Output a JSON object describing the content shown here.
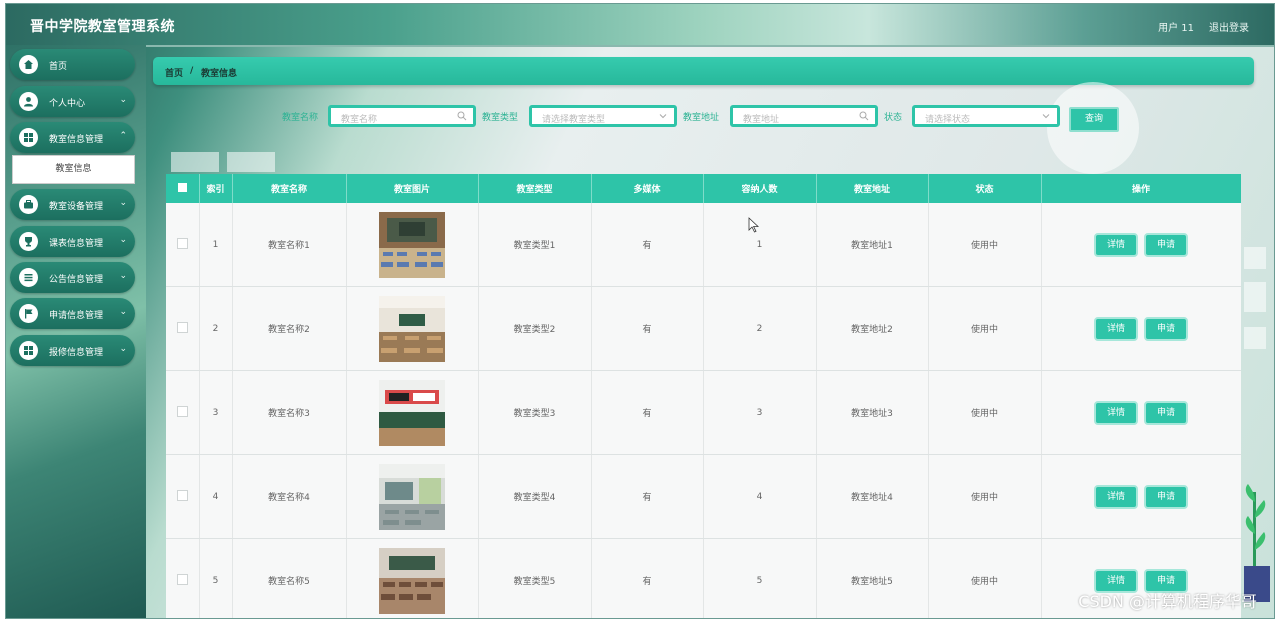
{
  "header": {
    "title": "晋中学院教室管理系统",
    "user": "用户 11",
    "logout": "退出登录"
  },
  "sidebar": {
    "items": [
      {
        "label": "首页",
        "icon": "home-icon",
        "expandable": false
      },
      {
        "label": "个人中心",
        "icon": "user-icon",
        "expandable": true
      },
      {
        "label": "教室信息管理",
        "icon": "grid-icon",
        "expandable": true
      },
      {
        "label": "教室设备管理",
        "icon": "briefcase-icon",
        "expandable": true
      },
      {
        "label": "课表信息管理",
        "icon": "cup-icon",
        "expandable": true
      },
      {
        "label": "公告信息管理",
        "icon": "list-icon",
        "expandable": true
      },
      {
        "label": "申请信息管理",
        "icon": "flag-icon",
        "expandable": true
      },
      {
        "label": "报修信息管理",
        "icon": "grid-icon",
        "expandable": true
      }
    ],
    "sub_item": "教室信息"
  },
  "breadcrumb": {
    "home": "首页",
    "sep": "/",
    "current": "教室信息"
  },
  "search": {
    "name_label": "教室名称",
    "name_placeholder": "教室名称",
    "type_label": "教室类型",
    "type_placeholder": "请选择教室类型",
    "addr_label": "教室地址",
    "addr_placeholder": "教室地址",
    "status_label": "状态",
    "status_placeholder": "请选择状态",
    "query": "查询"
  },
  "table": {
    "headers": [
      "索引",
      "教室名称",
      "教室图片",
      "教室类型",
      "多媒体",
      "容纳人数",
      "教室地址",
      "状态",
      "操作"
    ],
    "rows": [
      {
        "index": "1",
        "name": "教室名称1",
        "type": "教室类型1",
        "media": "有",
        "capacity": "1",
        "address": "教室地址1",
        "status": "使用中"
      },
      {
        "index": "2",
        "name": "教室名称2",
        "type": "教室类型2",
        "media": "有",
        "capacity": "2",
        "address": "教室地址2",
        "status": "使用中"
      },
      {
        "index": "3",
        "name": "教室名称3",
        "type": "教室类型3",
        "media": "有",
        "capacity": "3",
        "address": "教室地址3",
        "status": "使用中"
      },
      {
        "index": "4",
        "name": "教室名称4",
        "type": "教室类型4",
        "media": "有",
        "capacity": "4",
        "address": "教室地址4",
        "status": "使用中"
      },
      {
        "index": "5",
        "name": "教室名称5",
        "type": "教室类型5",
        "media": "有",
        "capacity": "5",
        "address": "教室地址5",
        "status": "使用中"
      }
    ],
    "detail_label": "详情",
    "apply_label": "申请"
  },
  "watermark": "CSDN @计算机程序华哥",
  "colors": {
    "accent": "#2ec4a8",
    "sidebar_item": "#1c6f5f"
  }
}
